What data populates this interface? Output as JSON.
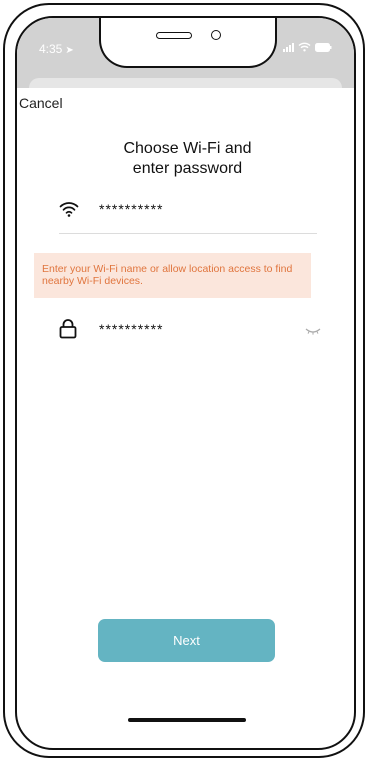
{
  "status_bar": {
    "time": "4:35",
    "location_icon": "location-arrow-icon",
    "signal_icon": "cellular-signal-icon",
    "wifi_icon": "wifi-icon",
    "battery_icon": "battery-icon"
  },
  "nav": {
    "cancel_label": "Cancel"
  },
  "title": {
    "line1": "Choose Wi-Fi and",
    "line2": "enter password"
  },
  "wifi_field": {
    "icon": "wifi-icon",
    "value": "**********"
  },
  "notice": {
    "text": "Enter your Wi-Fi name or allow location access to find nearby Wi-Fi devices."
  },
  "password_field": {
    "icon": "lock-icon",
    "value": "**********",
    "visibility_icon": "eye-closed-icon"
  },
  "actions": {
    "next_label": "Next"
  },
  "colors": {
    "accent_button": "#64b4c2",
    "notice_background": "#fbe6dc",
    "notice_text": "#e0753e",
    "status_bar": "#d2d2d2"
  }
}
